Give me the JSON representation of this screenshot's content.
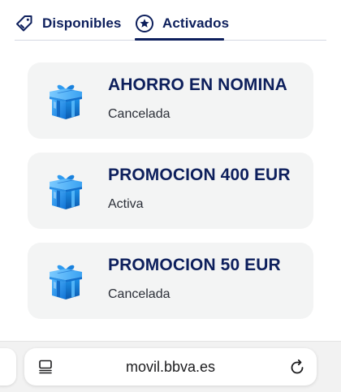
{
  "tabs": {
    "disponibles": {
      "label": "Disponibles",
      "icon": "tag-icon"
    },
    "activados": {
      "label": "Activados",
      "icon": "star-badge-icon",
      "selected": true
    }
  },
  "cards": [
    {
      "title": "AHORRO EN NOMINA",
      "status": "Cancelada",
      "icon": "gift-box-icon"
    },
    {
      "title": "PROMOCION 400 EUR",
      "status": "Activa",
      "icon": "gift-box-icon"
    },
    {
      "title": "PROMOCION 50 EUR",
      "status": "Cancelada",
      "icon": "gift-box-icon"
    }
  ],
  "browser": {
    "url": "movil.bbva.es",
    "left_icon": "tabs-overview-icon",
    "right_icon": "reload-icon"
  },
  "colors": {
    "brand_navy": "#0d1f5c",
    "card_bg": "#f3f4f4",
    "gift_blue": "#1d8fe6"
  }
}
